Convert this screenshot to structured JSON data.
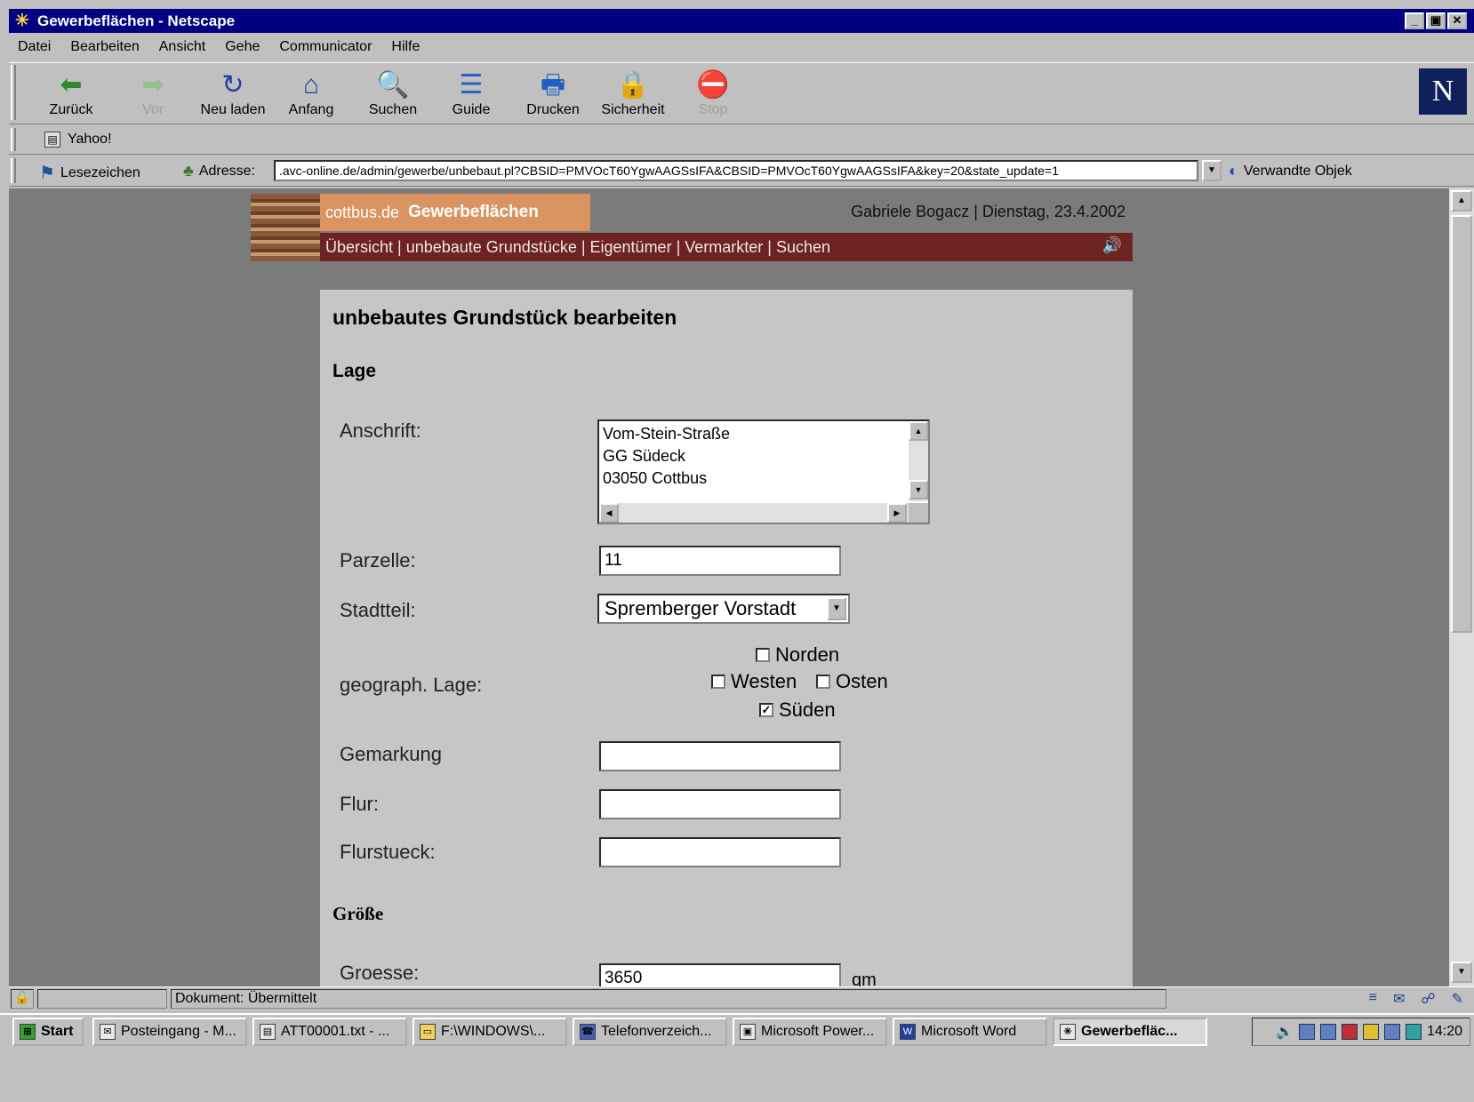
{
  "window": {
    "title": "Gewerbeflächen - Netscape",
    "min": "_",
    "max": "▣",
    "close": "✕"
  },
  "menu": [
    "Datei",
    "Bearbeiten",
    "Ansicht",
    "Gehe",
    "Communicator",
    "Hilfe"
  ],
  "toolbar": {
    "back": "Zurück",
    "forward": "Vor",
    "reload": "Neu laden",
    "home": "Anfang",
    "search": "Suchen",
    "guide": "Guide",
    "print": "Drucken",
    "security": "Sicherheit",
    "stop": "Stop"
  },
  "personal": {
    "yahoo": "Yahoo!"
  },
  "location": {
    "bookmarks": "Lesezeichen",
    "address_label": "Adresse:",
    "url": ".avc-online.de/admin/gewerbe/unbebaut.pl?CBSID=PMVOcT60YgwAAGSsIFA&CBSID=PMVOcT60YgwAAGSsIFA&key=20&state_update=1",
    "related": "Verwandte Objek"
  },
  "site": {
    "brand_small": "cottbus.de",
    "brand_bold": "Gewerbeflächen",
    "user_info": "Gabriele Bogacz | Dienstag, 23.4.2002",
    "nav": "Übersicht | unbebaute Grundstücke | Eigentümer | Vermarkter | Suchen"
  },
  "form": {
    "title": "unbebautes Grundstück bearbeiten",
    "section_lage": "Lage",
    "anschrift_label": "Anschrift:",
    "anschrift_lines": [
      "Vom-Stein-Straße",
      "GG Südeck",
      "03050 Cottbus"
    ],
    "parzelle_label": "Parzelle:",
    "parzelle_value": "11",
    "stadtteil_label": "Stadtteil:",
    "stadtteil_value": "Spremberger Vorstadt",
    "geo_label": "geograph. Lage:",
    "geo": {
      "norden": "Norden",
      "westen": "Westen",
      "osten": "Osten",
      "sueden": "Süden"
    },
    "geo_checked": {
      "norden": false,
      "westen": false,
      "osten": false,
      "sueden": true
    },
    "gemarkung_label": "Gemarkung",
    "flur_label": "Flur:",
    "flurstueck_label": "Flurstueck:",
    "section_groesse": "Größe",
    "groesse_label": "Groesse:",
    "groesse_value": "3650",
    "groesse_unit": "qm"
  },
  "status": {
    "text": "Dokument: Übermittelt"
  },
  "taskbar": {
    "start": "Start",
    "items": [
      "Posteingang - M...",
      "ATT00001.txt - ...",
      "F:\\WINDOWS\\...",
      "Telefonverzeich...",
      "Microsoft Power...",
      "Microsoft Word",
      "Gewerbefläc..."
    ],
    "clock": "14:20"
  }
}
